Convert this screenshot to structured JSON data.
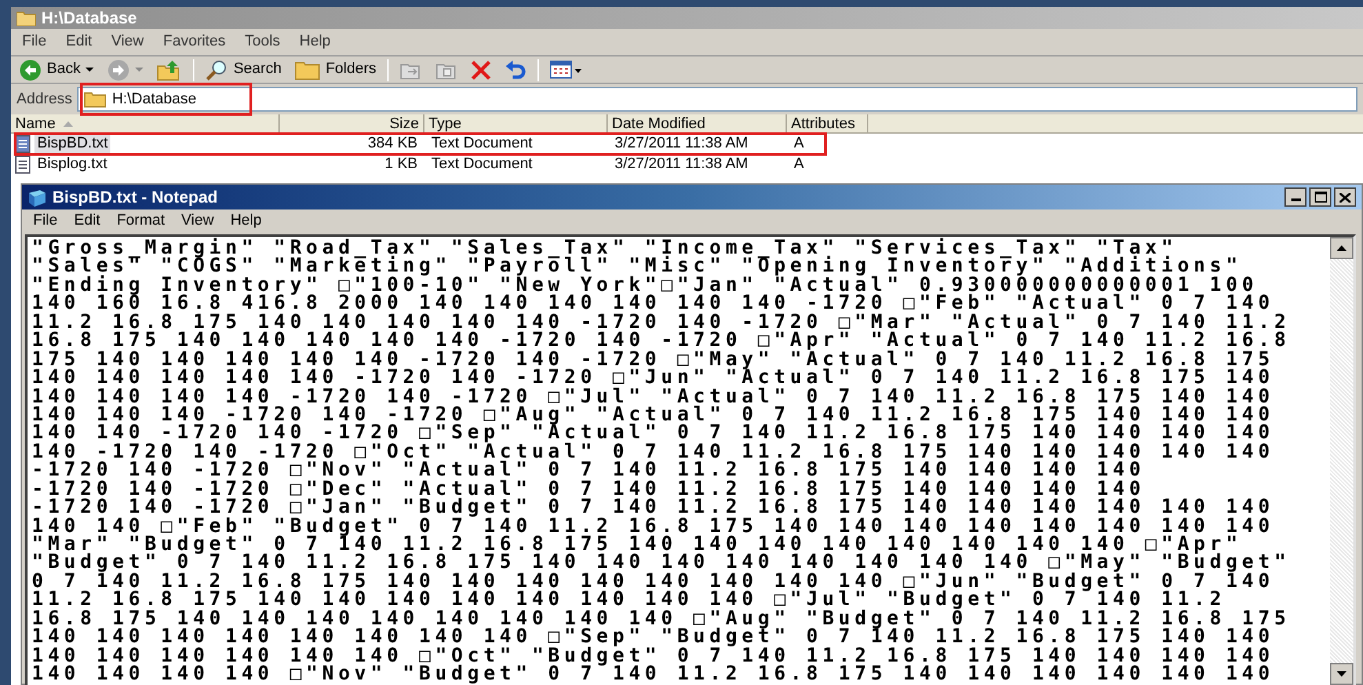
{
  "explorer": {
    "title": "H:\\Database",
    "menu": [
      "File",
      "Edit",
      "View",
      "Favorites",
      "Tools",
      "Help"
    ],
    "toolbar": [
      {
        "kind": "back",
        "label": "Back"
      },
      {
        "kind": "forward"
      },
      {
        "kind": "up"
      },
      {
        "kind": "search",
        "label": "Search"
      },
      {
        "kind": "folders",
        "label": "Folders"
      },
      {
        "kind": "move"
      },
      {
        "kind": "copy"
      },
      {
        "kind": "delete"
      },
      {
        "kind": "undo"
      },
      {
        "kind": "views"
      }
    ],
    "address": {
      "label": "Address",
      "value": "H:\\Database",
      "highlighted": true
    },
    "columns": [
      "Name",
      "Size",
      "Type",
      "Date Modified",
      "Attributes"
    ],
    "files": [
      {
        "name": "BispBD.txt",
        "size": "384 KB",
        "type": "Text Document",
        "modified": "3/27/2011 11:38 AM",
        "attributes": "A",
        "selected": true,
        "highlighted": true
      },
      {
        "name": "Bisplog.txt",
        "size": "1 KB",
        "type": "Text Document",
        "modified": "3/27/2011 11:38 AM",
        "attributes": "A",
        "selected": false,
        "highlighted": false
      }
    ]
  },
  "notepad": {
    "title": "BispBD.txt - Notepad",
    "menu": [
      "File",
      "Edit",
      "Format",
      "View",
      "Help"
    ],
    "lines": [
      "\"Gross_Margin\" \"Road_Tax\" \"Sales_Tax\" \"Income_Tax\" \"Services_Tax\" \"Tax\"",
      "\"Sales\" \"COGS\" \"Marketing\" \"Payroll\" \"Misc\" \"Opening Inventory\" \"Additions\"",
      "\"Ending Inventory\" □\"100-10\" \"New York\"□\"Jan\" \"Actual\" 0.930000000000001 100",
      "140 160 16.8 416.8 2000 140 140 140 140 140 140 -1720 □\"Feb\" \"Actual\" 0 7 140",
      "11.2 16.8 175 140 140 140 140 140 -1720 140 -1720 □\"Mar\" \"Actual\" 0 7 140 11.2",
      "16.8 175 140 140 140 140 140 -1720 140 -1720 □\"Apr\" \"Actual\" 0 7 140 11.2 16.8",
      "175 140 140 140 140 140 -1720 140 -1720 □\"May\" \"Actual\" 0 7 140 11.2 16.8 175",
      "140 140 140 140 140 -1720 140 -1720 □\"Jun\" \"Actual\" 0 7 140 11.2 16.8 175 140",
      "140 140 140 140 -1720 140 -1720 □\"Jul\" \"Actual\" 0 7 140 11.2 16.8 175 140 140",
      "140 140 140 -1720 140 -1720 □\"Aug\" \"Actual\" 0 7 140 11.2 16.8 175 140 140 140",
      "140 140 -1720 140 -1720 □\"Sep\" \"Actual\" 0 7 140 11.2 16.8 175 140 140 140 140",
      "140 -1720 140 -1720 □\"Oct\" \"Actual\" 0 7 140 11.2 16.8 175 140 140 140 140 140",
      "-1720 140 -1720 □\"Nov\" \"Actual\" 0 7 140 11.2 16.8 175 140 140 140 140",
      "-1720 140 -1720 □\"Dec\" \"Actual\" 0 7 140 11.2 16.8 175 140 140 140 140",
      "-1720 140 -1720 □\"Jan\" \"Budget\" 0 7 140 11.2 16.8 175 140 140 140 140 140 140",
      "140 140 □\"Feb\" \"Budget\" 0 7 140 11.2 16.8 175 140 140 140 140 140 140 140 140",
      "\"Mar\" \"Budget\" 0 7 140 11.2 16.8 175 140 140 140 140 140 140 140 140 □\"Apr\"",
      "\"Budget\" 0 7 140 11.2 16.8 175 140 140 140 140 140 140 140 140 □\"May\" \"Budget\"",
      "0 7 140 11.2 16.8 175 140 140 140 140 140 140 140 140 □\"Jun\" \"Budget\" 0 7 140",
      "11.2 16.8 175 140 140 140 140 140 140 140 140 □\"Jul\" \"Budget\" 0 7 140 11.2",
      "16.8 175 140 140 140 140 140 140 140 140 □\"Aug\" \"Budget\" 0 7 140 11.2 16.8 175",
      "140 140 140 140 140 140 140 140 □\"Sep\" \"Budget\" 0 7 140 11.2 16.8 175 140 140",
      "140 140 140 140 140 140 □\"Oct\" \"Budget\" 0 7 140 11.2 16.8 175 140 140 140 140",
      "140 140 140 140 □\"Nov\" \"Budget\" 0 7 140 11.2 16.8 175 140 140 140 140 140 140"
    ]
  }
}
